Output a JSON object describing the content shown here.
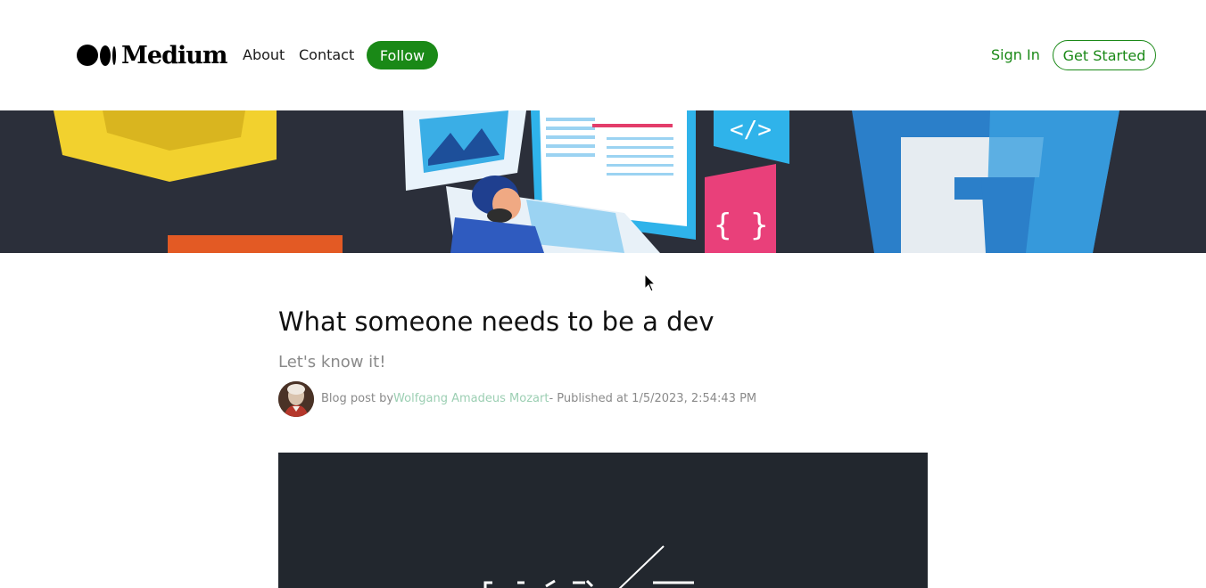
{
  "brand": {
    "name": "Medium"
  },
  "nav": {
    "about": "About",
    "contact": "Contact",
    "follow": "Follow",
    "sign_in": "Sign In",
    "get_started": "Get Started"
  },
  "article": {
    "title": "What someone needs to be a dev",
    "subtitle": "Let's know it!",
    "byline_prefix": "Blog post by",
    "author": "Wolfgang Amadeus Mozart",
    "published": "- Published at 1/5/2023, 2:54:43 PM"
  },
  "banner": {
    "code_tag": "</>",
    "braces": "{ }"
  },
  "colors": {
    "accent": "#1a8917",
    "author_link": "#9ccfb3",
    "banner_bg": "#2b2f3a",
    "hero_bg": "#22272e"
  }
}
